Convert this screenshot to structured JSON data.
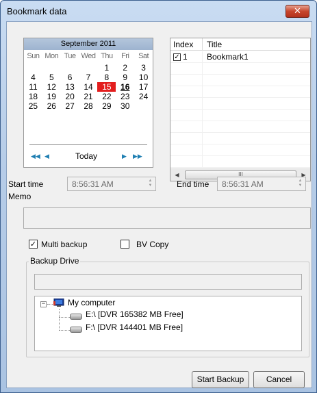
{
  "window": {
    "title": "Bookmark data",
    "close_glyph": "✕"
  },
  "calendar": {
    "month_label": "September 2011",
    "day_headers": [
      "Sun",
      "Mon",
      "Tue",
      "Wed",
      "Thu",
      "Fri",
      "Sat"
    ],
    "weeks": [
      [
        "",
        "",
        "",
        "",
        "1",
        "2",
        "3"
      ],
      [
        "4",
        "5",
        "6",
        "7",
        "8",
        "9",
        "10"
      ],
      [
        "11",
        "12",
        "13",
        "14",
        "15",
        "16",
        "17"
      ],
      [
        "18",
        "19",
        "20",
        "21",
        "22",
        "23",
        "24"
      ],
      [
        "25",
        "26",
        "27",
        "28",
        "29",
        "30",
        ""
      ]
    ],
    "selected_day": "15",
    "today_day": "16",
    "today_label": "Today",
    "nav": {
      "prev_year": "◀◀",
      "prev_month": "◀",
      "next_month": "▶",
      "next_year": "▶▶"
    }
  },
  "bookmark_list": {
    "columns": [
      "Index",
      "Title"
    ],
    "rows": [
      {
        "checked": true,
        "index": "1",
        "title": "Bookmark1"
      }
    ],
    "scroll_thumb_glyph": "III"
  },
  "start_time": {
    "label": "Start time",
    "value": "8:56:31 AM"
  },
  "end_time": {
    "label": "End time",
    "value": "8:56:31 AM"
  },
  "memo": {
    "label": "Memo",
    "value": ""
  },
  "options": {
    "multi_backup": {
      "label": "Multi backup",
      "checked": true
    },
    "bv_copy": {
      "label": "BV Copy",
      "checked": false
    }
  },
  "backup_drive": {
    "group_label": "Backup Drive",
    "path_value": "",
    "tree": {
      "root": "My computer",
      "drives": [
        "E:\\ [DVR 165382 MB Free]",
        "F:\\ [DVR 144401 MB Free]"
      ]
    }
  },
  "buttons": {
    "start_backup": "Start Backup",
    "cancel": "Cancel"
  },
  "colors": {
    "selected_day": "#e31e1e",
    "nav_arrows": "#1f7fb2",
    "title_bar": "#b7cde8"
  }
}
